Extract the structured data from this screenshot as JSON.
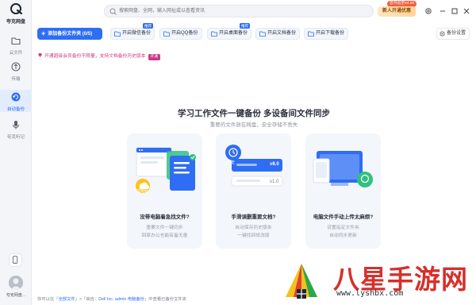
{
  "sidebar": {
    "logo_text": "夸克网盘",
    "items": [
      {
        "label": "云文件",
        "icon": "folder-icon"
      },
      {
        "label": "传输",
        "icon": "transfer-icon"
      },
      {
        "label": "自动备份",
        "icon": "backup-icon",
        "active": true
      },
      {
        "label": "夸克听记",
        "icon": "microphone-icon"
      }
    ],
    "user_name": "夸克网盘..."
  },
  "topbar": {
    "search_placeholder": "搜索网盘、全网，输入网址或以查看资讯",
    "promo_label": "新人开通优惠",
    "promo_badge": "首月低至¥4.80"
  },
  "toolbar": {
    "add_folder_label": "添加备份文件夹 (0/5)",
    "buttons": [
      {
        "label": "开启微信备份",
        "tag": "推荐"
      },
      {
        "label": "开启QQ备份",
        "tag": ""
      },
      {
        "label": "开启桌面备份",
        "tag": "推荐"
      },
      {
        "label": "开启文档备份",
        "tag": ""
      },
      {
        "label": "开启下载备份",
        "tag": ""
      }
    ],
    "settings_label": "备份设置"
  },
  "notice": {
    "text": "开通超级会员备份不限量，支持文档备份历史版本",
    "button": "开通"
  },
  "main": {
    "headline": "学习工作文件一键备份 多设备间文件同步",
    "subline": "重要的文件放在网盘，安全存储不丢失",
    "cards": [
      {
        "title": "没带电脑着急找文件?",
        "line1": "重要文件一键同步",
        "line2": "回家办公也能有备无患",
        "badge": "夸克网盘"
      },
      {
        "title": "手滑误删重要文档?",
        "line1": "自动保存历史版本",
        "line2": "一键找回修改版",
        "version_top": "v8.0",
        "version_bottom": "v1.0",
        "pill": "历史"
      },
      {
        "title": "电脑文件手动上传太麻烦?",
        "line1": "设置指定文件夹",
        "line2": "自动同步更新",
        "badge": "备份"
      }
    ]
  },
  "footer": {
    "prefix": "你可以在「",
    "link1": "全部文件",
    "mid": "」>「来自：",
    "link2": "Dell Inc. admin 电脑备份",
    "suffix": "」中查看已备份文件夹"
  },
  "watermark": {
    "text": "八星手游网",
    "url": "www.lyshbx.com"
  },
  "colors": {
    "accent": "#2e6df4",
    "sidebar_bg": "#f3f5f9",
    "notice": "#d4397a",
    "card_bg": "#f3f6fb",
    "watermark": "#d6302b"
  }
}
